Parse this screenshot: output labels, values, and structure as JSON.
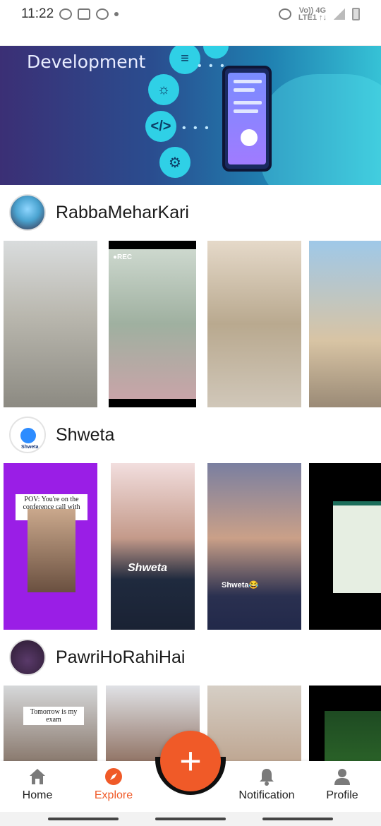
{
  "status_bar": {
    "time": "11:22",
    "network_top": "Vo)) 4G",
    "network_bottom": "LTE1 ↑↓",
    "icons": [
      "whatsapp-icon",
      "gallery-icon",
      "cloud-icon",
      "dot-icon",
      "hotspot-icon",
      "signal-icon",
      "battery-icon"
    ]
  },
  "banner": {
    "title": "Development"
  },
  "sections": [
    {
      "channel": "RabbaMeharKari",
      "thumbnails": [
        {
          "overlay": ""
        },
        {
          "overlay": "●REC"
        },
        {
          "overlay": ""
        },
        {
          "overlay": ""
        }
      ]
    },
    {
      "channel": "Shweta",
      "avatar_label": "Shweta",
      "thumbnails": [
        {
          "overlay": "POV: You're on the conference call with Shweta"
        },
        {
          "overlay": "Shweta"
        },
        {
          "overlay": "Shweta😂"
        },
        {
          "overlay": ""
        }
      ]
    },
    {
      "channel": "PawriHoRahiHai",
      "thumbnails": [
        {
          "overlay": "Tomorrow is my exam"
        },
        {
          "overlay": ""
        },
        {
          "overlay": ""
        },
        {
          "overlay": ""
        }
      ]
    }
  ],
  "fab": {
    "label": "+"
  },
  "bottom_nav": {
    "items": [
      {
        "label": "Home",
        "icon": "home-icon"
      },
      {
        "label": "Explore",
        "icon": "compass-icon",
        "active": true
      },
      {
        "label": "Notification",
        "icon": "bell-icon"
      },
      {
        "label": "Profile",
        "icon": "person-icon"
      }
    ],
    "accent_color": "#f05a28"
  }
}
